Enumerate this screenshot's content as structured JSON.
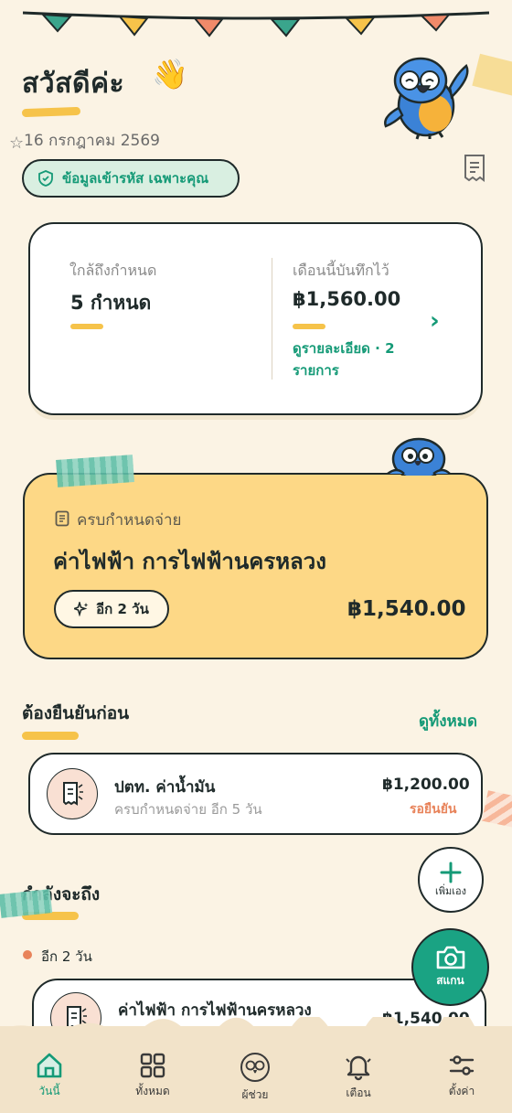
{
  "header": {
    "greeting": "สวัสดีค่ะ",
    "wave_emoji": "👋",
    "date": "16 กรกฎาคม 2569",
    "privacy_badge": "ข้อมูลเข้ารหัส เฉพาะคุณ"
  },
  "summary": {
    "upcoming_label": "ใกล้ถึงกำหนด",
    "upcoming_value": "5 กำหนด",
    "month_label": "เดือนนี้บันทึกไว้",
    "month_value": "฿1,560.00",
    "details_link": "ดูรายละเอียด · 2 รายการ"
  },
  "due_card": {
    "label": "ครบกำหนดจ่าย",
    "title": "ค่าไฟฟ้า การไฟฟ้านครหลวง",
    "days_left": "อีก 2 วัน",
    "amount": "฿1,540.00"
  },
  "pending_section": {
    "title": "ต้องยืนยันก่อน",
    "see_all": "ดูทั้งหมด",
    "items": [
      {
        "name": "ปตท. ค่าน้ำมัน",
        "subtitle": "ครบกำหนดจ่าย อีก 5 วัน",
        "amount": "฿1,200.00",
        "status": "รอยืนยัน"
      }
    ]
  },
  "upcoming_section": {
    "title": "กำลังจะถึง",
    "group_label": "อีก 2 วัน",
    "items": [
      {
        "name": "ค่าไฟฟ้า การไฟฟ้านครหลวง",
        "amount": "฿1,540.00"
      }
    ]
  },
  "fabs": {
    "add_label": "เพิ่มเอง",
    "scan_label": "สแกน"
  },
  "bottom_nav": [
    {
      "label": "วันนี้",
      "icon": "home-icon",
      "active": true
    },
    {
      "label": "ทั้งหมด",
      "icon": "grid-icon",
      "active": false
    },
    {
      "label": "ผู้ช่วย",
      "icon": "parrot-icon",
      "active": false
    },
    {
      "label": "เตือน",
      "icon": "bell-icon",
      "active": false
    },
    {
      "label": "ตั้งค่า",
      "icon": "sliders-icon",
      "active": false
    }
  ],
  "colors": {
    "background": "#fbf3e4",
    "accent_green": "#159a77",
    "due_card_yellow": "#fdd886",
    "highlight_yellow": "#f6c34a",
    "status_orange": "#e8835a"
  }
}
